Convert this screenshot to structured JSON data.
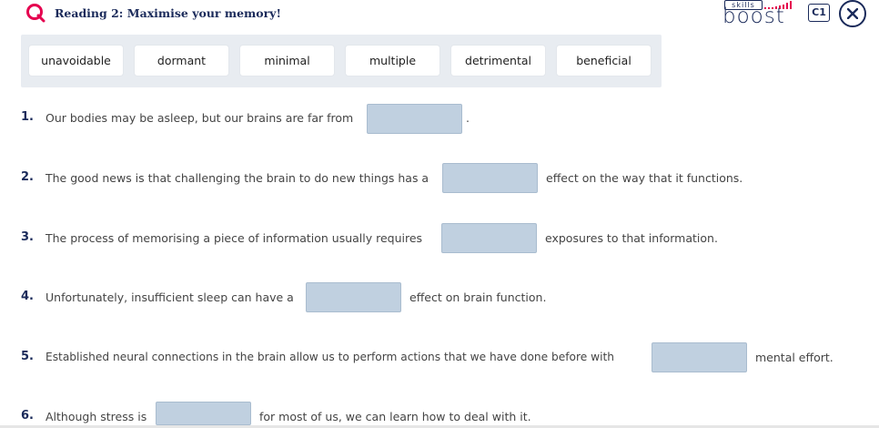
{
  "header": {
    "title": "Reading 2: Maximise your memory!",
    "brand_top": "skills",
    "brand_word": "boost",
    "level": "C1",
    "accent": "#e5004f",
    "navy": "#1a2a5a"
  },
  "word_bank": [
    "unavoidable",
    "dormant",
    "minimal",
    "multiple",
    "detrimental",
    "beneficial"
  ],
  "questions": [
    {
      "num": "1.",
      "before": "Our bodies may be asleep, but our brains are far from",
      "after": "."
    },
    {
      "num": "2.",
      "before": "The good news is that challenging the brain to do new things has a",
      "after": "effect on the way that it functions."
    },
    {
      "num": "3.",
      "before": "The process of memorising a piece of information usually requires",
      "after": "exposures to that information."
    },
    {
      "num": "4.",
      "before": "Unfortunately, insufficient sleep can have a",
      "after": "effect on brain function."
    },
    {
      "num": "5.",
      "before": "Established neural connections in the brain allow us to perform actions that we have done before with",
      "after": "mental effort."
    },
    {
      "num": "6.",
      "before": "Although stress is",
      "after": "for most of us, we can learn how to deal with it."
    }
  ]
}
